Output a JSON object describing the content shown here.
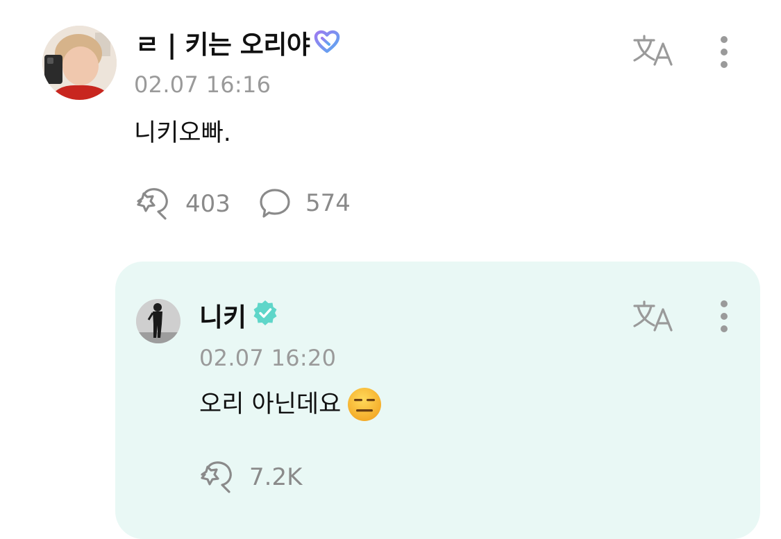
{
  "post": {
    "username": "ㄹ | 키는 오리야",
    "timestamp": "02.07 16:16",
    "text": "니키오빠.",
    "likes": "403",
    "comments": "574",
    "avatar_icon": "user-photo-avatar",
    "badge_icon": "heart-membership-badge"
  },
  "reply": {
    "username": "니키",
    "timestamp": "02.07 16:20",
    "text": "오리 아닌데요",
    "emoji": "expressionless-face-emoji",
    "likes": "7.2K",
    "avatar_icon": "artist-photo-avatar",
    "badge_icon": "verified-badge"
  },
  "colors": {
    "reply_background": "#e9f8f5",
    "verified": "#5fd6c9",
    "muted_text": "#9a9a9a",
    "icon_gray": "#8a8a8a"
  }
}
